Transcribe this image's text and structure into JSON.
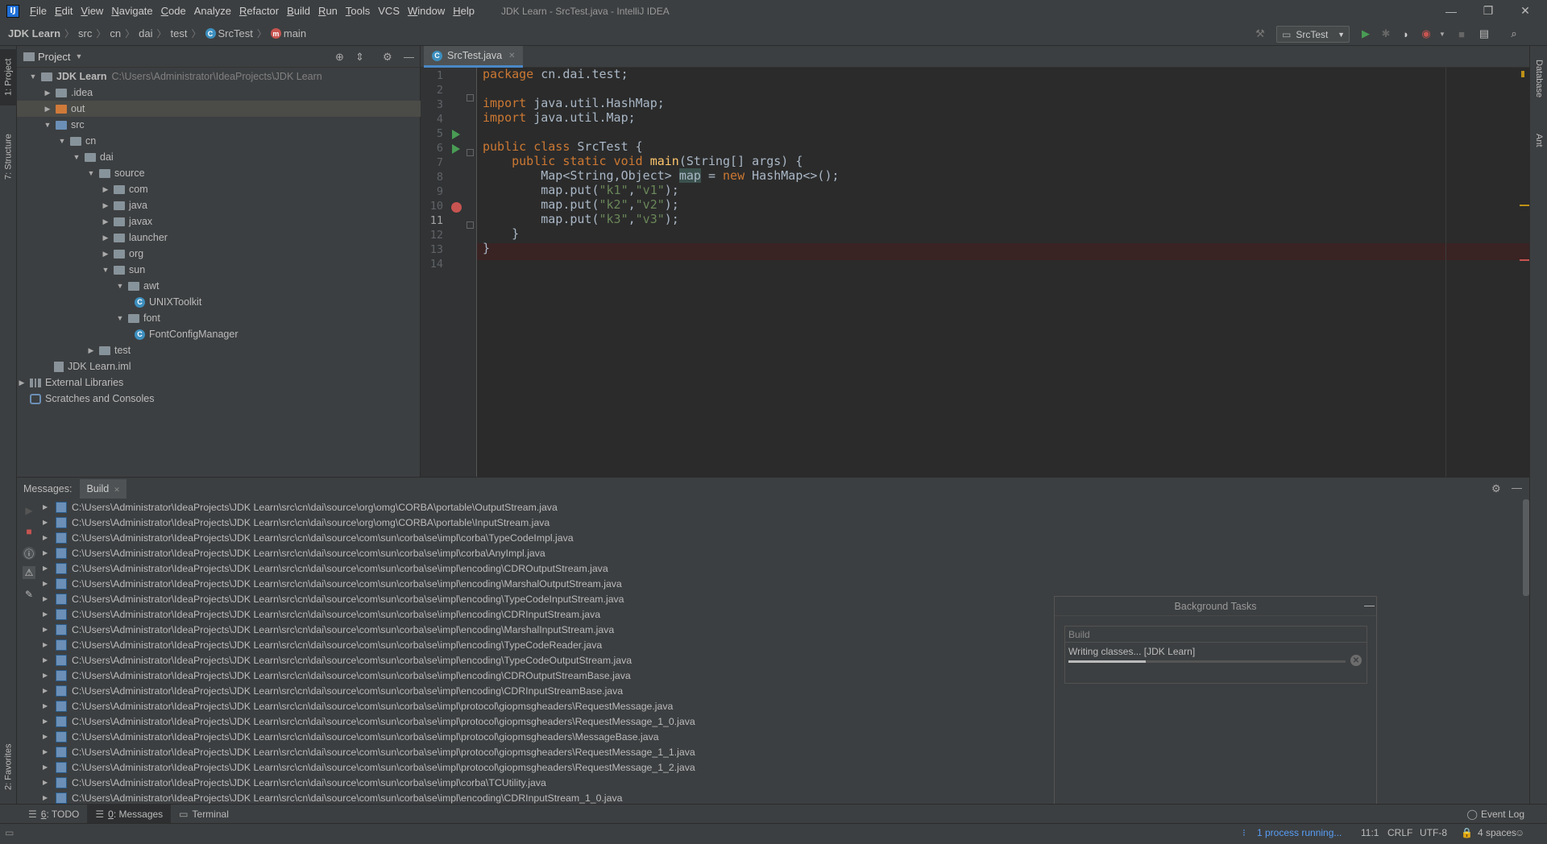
{
  "window": {
    "title": "JDK Learn - SrcTest.java - IntelliJ IDEA",
    "logo": "IJ",
    "minimize": "—",
    "restore": "❐",
    "close": "✕"
  },
  "menu": [
    {
      "u": "F",
      "rest": "ile"
    },
    {
      "u": "E",
      "rest": "dit"
    },
    {
      "u": "V",
      "rest": "iew"
    },
    {
      "u": "N",
      "rest": "avigate"
    },
    {
      "u": "C",
      "rest": "ode"
    },
    {
      "u": "",
      "rest": "Analyze"
    },
    {
      "u": "R",
      "rest": "efactor"
    },
    {
      "u": "B",
      "rest": "uild"
    },
    {
      "u": "R",
      "rest": "un"
    },
    {
      "u": "T",
      "rest": "ools"
    },
    {
      "u": "",
      "rest": "VCS"
    },
    {
      "u": "W",
      "rest": "indow"
    },
    {
      "u": "H",
      "rest": "elp"
    }
  ],
  "breadcrumb": [
    "JDK Learn",
    "src",
    "cn",
    "dai",
    "test",
    "SrcTest",
    "main"
  ],
  "run_config": "SrcTest",
  "project": {
    "title": "Project",
    "root_path": "C:\\Users\\Administrator\\IdeaProjects\\JDK Learn",
    "tree": [
      "JDK Learn",
      ".idea",
      "out",
      "src",
      "cn",
      "dai",
      "source",
      "com",
      "java",
      "javax",
      "launcher",
      "org",
      "sun",
      "awt",
      "UNIXToolkit",
      "font",
      "FontConfigManager",
      "test",
      "JDK Learn.iml",
      "External Libraries",
      "Scratches and Consoles"
    ]
  },
  "left_tabs": {
    "project": "1: Project",
    "structure": "7: Structure",
    "favorites": "2: Favorites"
  },
  "right_tabs": {
    "database": "Database",
    "ant": "Ant"
  },
  "editor": {
    "tab": "SrcTest.java",
    "line_numbers": [
      "1",
      "2",
      "3",
      "4",
      "5",
      "6",
      "7",
      "8",
      "9",
      "10",
      "11",
      "12",
      "13",
      "14"
    ]
  },
  "code": {
    "l1_kw": "package",
    "l1_rest": " cn.dai.test;",
    "l3_kw": "import",
    "l3_rest": " java.util.HashMap;",
    "l4_kw": "import",
    "l4_rest": " java.util.Map;",
    "l6_kw": "public class",
    "l6_rest": " SrcTest {",
    "l7_kw": "    public static void ",
    "l7_fn": "main",
    "l7_rest": "(String[] args) {",
    "l8_a": "        Map<String,Object> ",
    "l8_var": "map",
    "l8_b": " = ",
    "l8_kw": "new",
    "l8_c": " HashMap<>();",
    "l9_a": "        map.put(",
    "l9_s1": "\"k1\"",
    "l9_b": ",",
    "l9_s2": "\"v1\"",
    "l9_c": ");",
    "l10_a": "        map.put(",
    "l10_s1": "\"k2\"",
    "l10_b": ",",
    "l10_s2": "\"v2\"",
    "l10_c": ");",
    "l11_a": "        map.put(",
    "l11_s1": "\"k3\"",
    "l11_b": ",",
    "l11_s2": "\"v3\"",
    "l11_c": ");",
    "l12": "    }",
    "l13": "}"
  },
  "messages": {
    "label": "Messages:",
    "tab": "Build",
    "rows": [
      "C:\\Users\\Administrator\\IdeaProjects\\JDK Learn\\src\\cn\\dai\\source\\org\\omg\\CORBA\\portable\\OutputStream.java",
      "C:\\Users\\Administrator\\IdeaProjects\\JDK Learn\\src\\cn\\dai\\source\\org\\omg\\CORBA\\portable\\InputStream.java",
      "C:\\Users\\Administrator\\IdeaProjects\\JDK Learn\\src\\cn\\dai\\source\\com\\sun\\corba\\se\\impl\\corba\\TypeCodeImpl.java",
      "C:\\Users\\Administrator\\IdeaProjects\\JDK Learn\\src\\cn\\dai\\source\\com\\sun\\corba\\se\\impl\\corba\\AnyImpl.java",
      "C:\\Users\\Administrator\\IdeaProjects\\JDK Learn\\src\\cn\\dai\\source\\com\\sun\\corba\\se\\impl\\encoding\\CDROutputStream.java",
      "C:\\Users\\Administrator\\IdeaProjects\\JDK Learn\\src\\cn\\dai\\source\\com\\sun\\corba\\se\\impl\\encoding\\MarshalOutputStream.java",
      "C:\\Users\\Administrator\\IdeaProjects\\JDK Learn\\src\\cn\\dai\\source\\com\\sun\\corba\\se\\impl\\encoding\\TypeCodeInputStream.java",
      "C:\\Users\\Administrator\\IdeaProjects\\JDK Learn\\src\\cn\\dai\\source\\com\\sun\\corba\\se\\impl\\encoding\\CDRInputStream.java",
      "C:\\Users\\Administrator\\IdeaProjects\\JDK Learn\\src\\cn\\dai\\source\\com\\sun\\corba\\se\\impl\\encoding\\MarshalInputStream.java",
      "C:\\Users\\Administrator\\IdeaProjects\\JDK Learn\\src\\cn\\dai\\source\\com\\sun\\corba\\se\\impl\\encoding\\TypeCodeReader.java",
      "C:\\Users\\Administrator\\IdeaProjects\\JDK Learn\\src\\cn\\dai\\source\\com\\sun\\corba\\se\\impl\\encoding\\TypeCodeOutputStream.java",
      "C:\\Users\\Administrator\\IdeaProjects\\JDK Learn\\src\\cn\\dai\\source\\com\\sun\\corba\\se\\impl\\encoding\\CDROutputStreamBase.java",
      "C:\\Users\\Administrator\\IdeaProjects\\JDK Learn\\src\\cn\\dai\\source\\com\\sun\\corba\\se\\impl\\encoding\\CDRInputStreamBase.java",
      "C:\\Users\\Administrator\\IdeaProjects\\JDK Learn\\src\\cn\\dai\\source\\com\\sun\\corba\\se\\impl\\protocol\\giopmsgheaders\\RequestMessage.java",
      "C:\\Users\\Administrator\\IdeaProjects\\JDK Learn\\src\\cn\\dai\\source\\com\\sun\\corba\\se\\impl\\protocol\\giopmsgheaders\\RequestMessage_1_0.java",
      "C:\\Users\\Administrator\\IdeaProjects\\JDK Learn\\src\\cn\\dai\\source\\com\\sun\\corba\\se\\impl\\protocol\\giopmsgheaders\\MessageBase.java",
      "C:\\Users\\Administrator\\IdeaProjects\\JDK Learn\\src\\cn\\dai\\source\\com\\sun\\corba\\se\\impl\\protocol\\giopmsgheaders\\RequestMessage_1_1.java",
      "C:\\Users\\Administrator\\IdeaProjects\\JDK Learn\\src\\cn\\dai\\source\\com\\sun\\corba\\se\\impl\\protocol\\giopmsgheaders\\RequestMessage_1_2.java",
      "C:\\Users\\Administrator\\IdeaProjects\\JDK Learn\\src\\cn\\dai\\source\\com\\sun\\corba\\se\\impl\\corba\\TCUtility.java",
      "C:\\Users\\Administrator\\IdeaProjects\\JDK Learn\\src\\cn\\dai\\source\\com\\sun\\corba\\se\\impl\\encoding\\CDRInputStream_1_0.java"
    ]
  },
  "background_tasks": {
    "title": "Background Tasks",
    "group": "Build",
    "task": "Writing classes... [JDK Learn]",
    "progress": 0.28
  },
  "tool_tabs": {
    "todo_num": "6",
    "todo": ": TODO",
    "messages_num": "0",
    "messages": ": Messages",
    "terminal": "Terminal",
    "event_log": "Event Log"
  },
  "status": {
    "process": "1 process running...",
    "position": "11:1",
    "line_sep": "CRLF",
    "encoding": "UTF-8",
    "indent": "4 spaces"
  },
  "icons": [
    "search-icon",
    "settings-icon",
    "hide-icon",
    "run-icon",
    "debug-icon",
    "stop-icon",
    "build-hammer-icon",
    "breakpoint-icon",
    "class-icon",
    "method-icon",
    "folder-icon",
    "library-icon",
    "lock-icon"
  ],
  "colors": {
    "keyword": "#cc7832",
    "string": "#6a8759",
    "function": "#ffc66d",
    "breakpoint": "#c75450",
    "run": "#499c54",
    "accent": "#4a88c7"
  }
}
